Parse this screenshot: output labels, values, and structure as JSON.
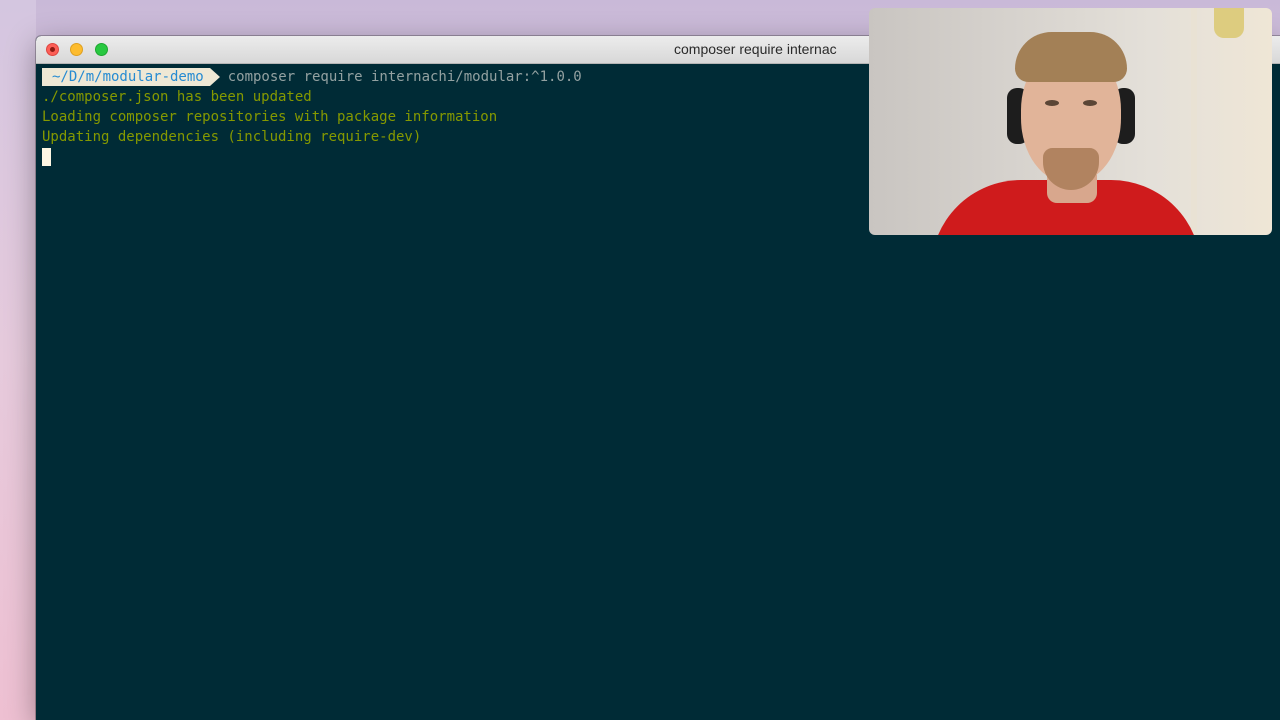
{
  "window": {
    "title": "composer require internac"
  },
  "terminal": {
    "prompt_path": "~/D/m/modular-demo",
    "command": "composer require internachi/modular:^1.0.0",
    "output": [
      "./composer.json has been updated",
      "Loading composer repositories with package information",
      "Updating dependencies (including require-dev)"
    ]
  },
  "colors": {
    "terminal_bg": "#002b36",
    "output_text": "#859900",
    "prompt_path": "#268bd2",
    "prompt_bg": "#eee8d5",
    "command_text": "#93a1a1"
  }
}
